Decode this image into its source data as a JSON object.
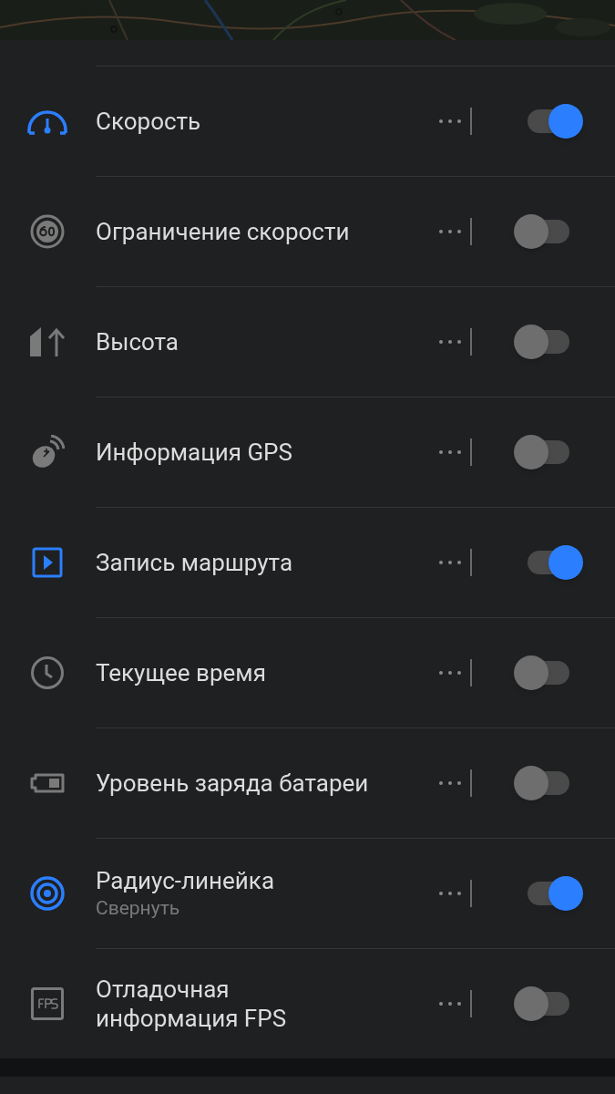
{
  "widgets": [
    {
      "kind": "speed",
      "label": "Скорость",
      "on": true
    },
    {
      "kind": "speed-limit",
      "label": "Ограничение скорости",
      "on": false
    },
    {
      "kind": "altitude",
      "label": "Высота",
      "on": false
    },
    {
      "kind": "gps",
      "label": "Информация GPS",
      "on": false
    },
    {
      "kind": "track",
      "label": "Запись маршрута",
      "on": true
    },
    {
      "kind": "clock",
      "label": "Текущее время",
      "on": false
    },
    {
      "kind": "battery",
      "label": "Уровень заряда батареи",
      "on": false
    },
    {
      "kind": "ruler",
      "label": "Радиус-линейка",
      "sublabel": "Свернуть",
      "on": true
    },
    {
      "kind": "fps",
      "label": "Отладочная информация FPS",
      "on": false
    }
  ]
}
